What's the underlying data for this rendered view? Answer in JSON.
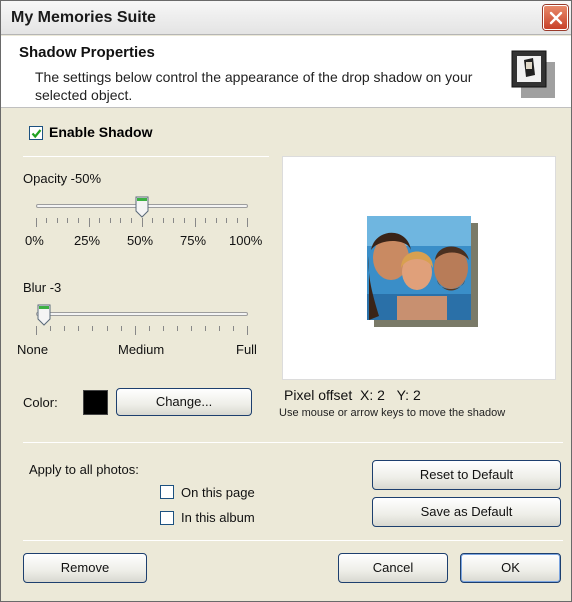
{
  "window": {
    "title": "My Memories Suite"
  },
  "header": {
    "title": "Shadow Properties",
    "description": "The settings below control the appearance of the drop shadow on your selected object.",
    "icon": "shadow-properties-icon"
  },
  "enable_shadow": {
    "label": "Enable Shadow",
    "checked": true
  },
  "opacity": {
    "label": "Opacity -50%",
    "value_percent": 50,
    "tick_labels": [
      "0%",
      "25%",
      "50%",
      "75%",
      "100%"
    ]
  },
  "blur": {
    "label": "Blur -3",
    "value": 3,
    "tick_labels": [
      "None",
      "Medium",
      "Full"
    ]
  },
  "color": {
    "label": "Color:",
    "value": "#000000",
    "change_button": "Change..."
  },
  "preview": {
    "pixel_offset_label": "Pixel offset",
    "x_label": "X:",
    "x_value": "2",
    "y_label": "Y:",
    "y_value": "2",
    "hint": "Use mouse or arrow keys to move the shadow"
  },
  "apply": {
    "label": "Apply to all photos:",
    "on_this_page": {
      "label": "On this page",
      "checked": false
    },
    "in_this_album": {
      "label": "In this album",
      "checked": false
    }
  },
  "buttons": {
    "reset_default": "Reset to Default",
    "save_default": "Save as Default",
    "remove": "Remove",
    "cancel": "Cancel",
    "ok": "OK"
  },
  "colors": {
    "accent": "#1d3f6e",
    "checkmark": "#21a121",
    "thumb": "#4caf50",
    "close": "#c8412a"
  }
}
